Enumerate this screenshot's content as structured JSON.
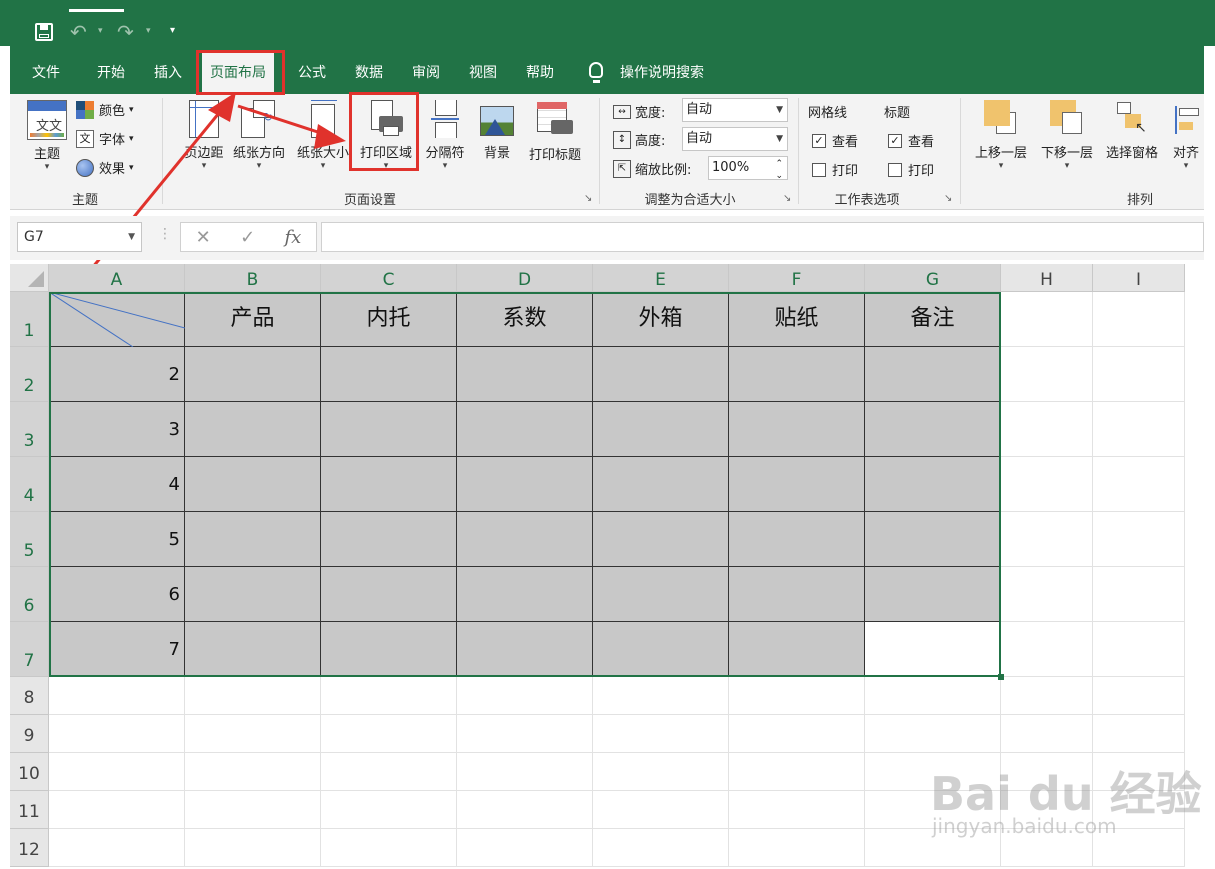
{
  "ribbon_tabs": [
    "文件",
    "开始",
    "插入",
    "页面布局",
    "公式",
    "数据",
    "审阅",
    "视图",
    "帮助"
  ],
  "tell_me": "操作说明搜索",
  "themes_group": {
    "label": "主题",
    "theme_button": "主题",
    "colors": "颜色",
    "fonts": "字体",
    "effects": "效果"
  },
  "page_setup_group": {
    "label": "页面设置",
    "margins": "页边距",
    "orientation": "纸张方向",
    "size": "纸张大小",
    "print_area": "打印区域",
    "breaks": "分隔符",
    "background": "背景",
    "print_titles": "打印标题"
  },
  "scale_group": {
    "label": "调整为合适大小",
    "width_label": "宽度:",
    "width_value": "自动",
    "height_label": "高度:",
    "height_value": "自动",
    "scale_label": "缩放比例:",
    "scale_value": "100%"
  },
  "sheet_options_group": {
    "label": "工作表选项",
    "gridlines": "网格线",
    "headings": "标题",
    "view": "查看",
    "print": "打印"
  },
  "arrange_group": {
    "label": "排列",
    "bring_forward": "上移一层",
    "send_backward": "下移一层",
    "selection_pane": "选择窗格",
    "align": "对齐"
  },
  "name_box": "G7",
  "columns": [
    "A",
    "B",
    "C",
    "D",
    "E",
    "F",
    "G",
    "H",
    "I"
  ],
  "rows": [
    "1",
    "2",
    "3",
    "4",
    "5",
    "6",
    "7",
    "8",
    "9",
    "10",
    "11",
    "12"
  ],
  "table_headers": [
    "产品",
    "内托",
    "系数",
    "外箱",
    "贴纸",
    "备注"
  ],
  "row_values": [
    "2",
    "3",
    "4",
    "5",
    "6",
    "7"
  ],
  "watermark": {
    "brand": "Bai du 经验",
    "url": "jingyan.baidu.com"
  },
  "colors": {
    "excel_green": "#217346",
    "table_fill": "#c8c8c8",
    "highlight_red": "#e0322c"
  }
}
